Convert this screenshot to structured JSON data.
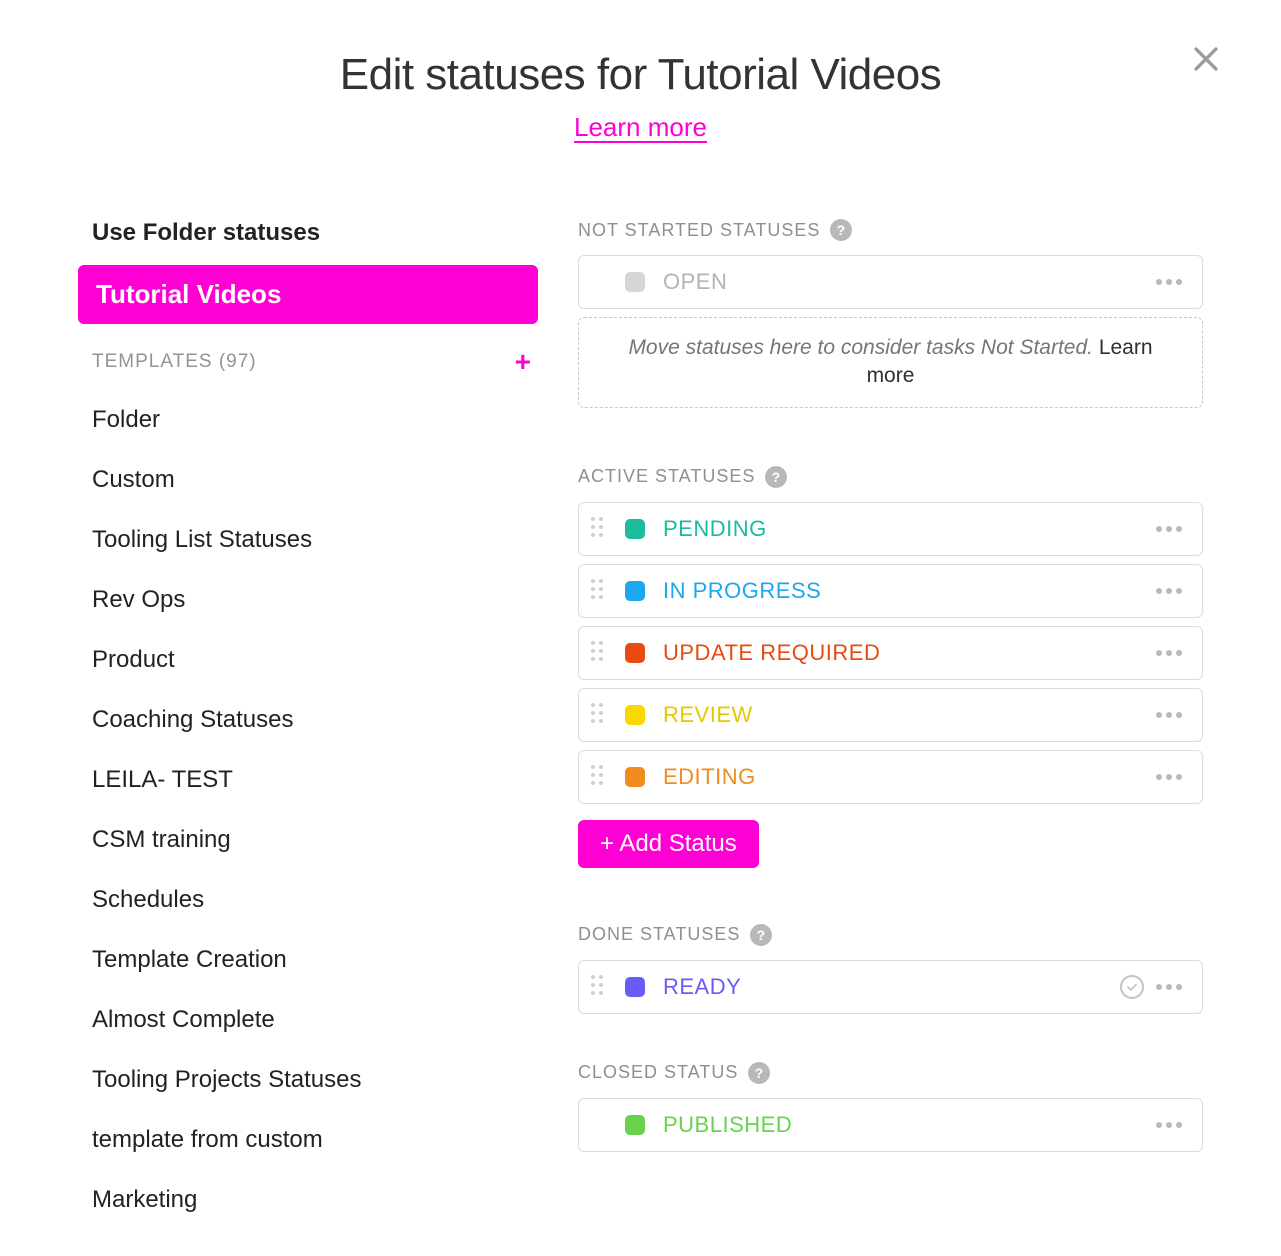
{
  "header": {
    "title": "Edit statuses for Tutorial Videos",
    "learn_more": "Learn more"
  },
  "sidebar": {
    "use_folder_label": "Use Folder statuses",
    "selected": "Tutorial Videos",
    "templates_label": "TEMPLATES (97)",
    "templates": [
      "Folder",
      "Custom",
      "Tooling List Statuses",
      "Rev Ops",
      "Product",
      "Coaching Statuses",
      "LEILA- TEST",
      "CSM training",
      "Schedules",
      "Template Creation",
      "Almost Complete",
      "Tooling Projects Statuses",
      "template from custom",
      "Marketing"
    ]
  },
  "sections": {
    "not_started": {
      "title": "NOT STARTED STATUSES"
    },
    "active": {
      "title": "ACTIVE STATUSES"
    },
    "done": {
      "title": "DONE STATUSES"
    },
    "closed": {
      "title": "CLOSED STATUS"
    }
  },
  "statuses": {
    "not_started": [
      {
        "name": "OPEN",
        "swatch": "#d6d6d6",
        "text_color": "#b4b4b4",
        "draggable": false
      }
    ],
    "active": [
      {
        "name": "PENDING",
        "swatch": "#1bbc9c",
        "text_color": "#1bbc9c",
        "draggable": true
      },
      {
        "name": "IN PROGRESS",
        "swatch": "#1da7ee",
        "text_color": "#1da7ee",
        "draggable": true
      },
      {
        "name": "UPDATE REQUIRED",
        "swatch": "#e84b0f",
        "text_color": "#e84b0f",
        "draggable": true
      },
      {
        "name": "REVIEW",
        "swatch": "#f7d900",
        "text_color": "#e5c800",
        "draggable": true
      },
      {
        "name": "EDITING",
        "swatch": "#f08c1e",
        "text_color": "#f08c1e",
        "draggable": true
      }
    ],
    "done": [
      {
        "name": "READY",
        "swatch": "#6a5bf6",
        "text_color": "#6a5bf6",
        "draggable": true,
        "check": true
      }
    ],
    "closed": [
      {
        "name": "PUBLISHED",
        "swatch": "#68d24d",
        "text_color": "#68d24d",
        "draggable": false
      }
    ]
  },
  "dropzone": {
    "text_prefix": "Move statuses here to consider tasks Not Started. ",
    "learn_more": "Learn more"
  },
  "buttons": {
    "add_status": "+ Add Status"
  }
}
